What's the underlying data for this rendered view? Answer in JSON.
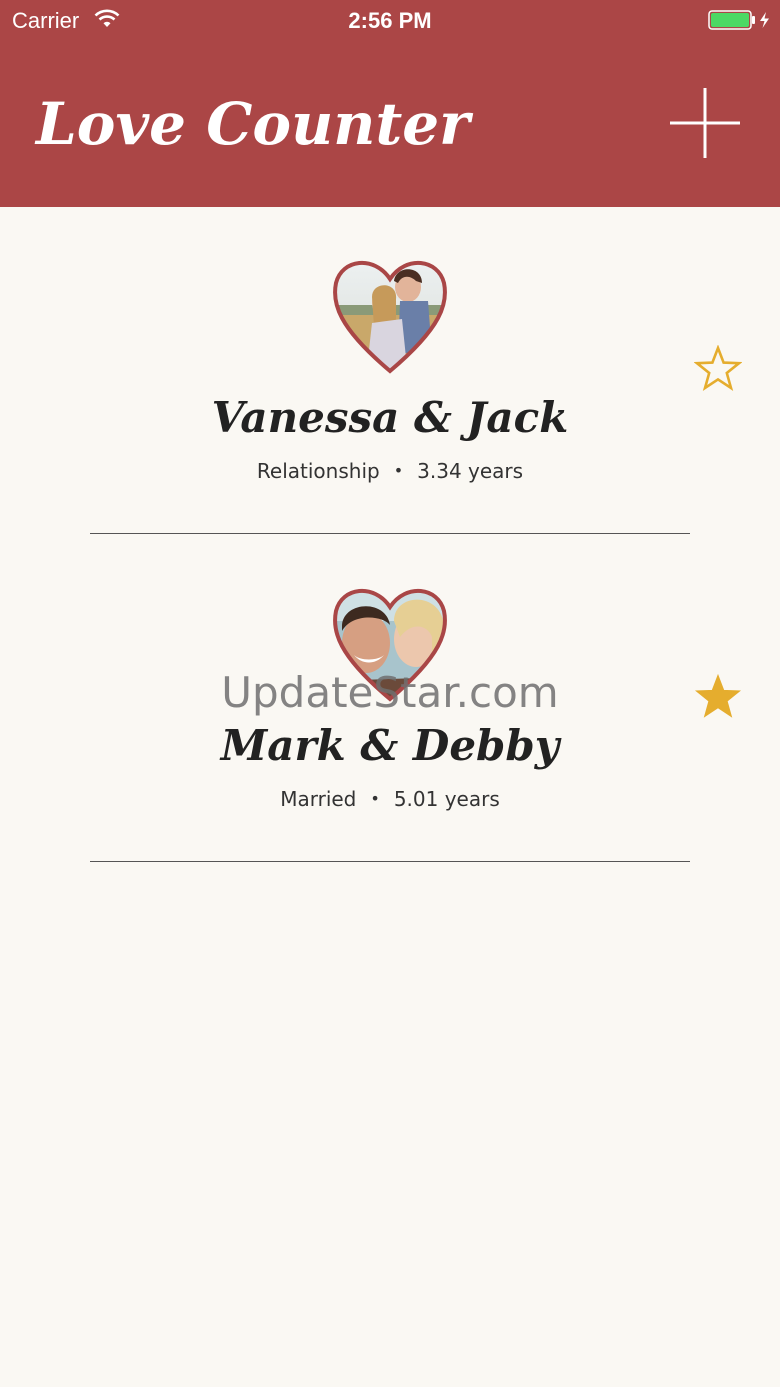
{
  "status_bar": {
    "carrier": "Carrier",
    "time": "2:56 PM",
    "wifi_icon": "wifi-icon",
    "battery_icon": "battery-charging-icon",
    "battery_color": "#4cd964"
  },
  "nav": {
    "title": "Love Counter",
    "add_icon": "plus-icon",
    "background": "#ab4646"
  },
  "couples": [
    {
      "names": "Vanessa & Jack",
      "status": "Relationship",
      "duration": "3.34 years",
      "favorite": false,
      "photo_icon": "heart-photo"
    },
    {
      "names": "Mark & Debby",
      "status": "Married",
      "duration": "5.01 years",
      "favorite": true,
      "photo_icon": "heart-photo"
    }
  ],
  "watermark": "UpdateStar.com",
  "colors": {
    "star": "#e5ad2e",
    "heart_border": "#a94646",
    "background": "#faf8f3"
  }
}
